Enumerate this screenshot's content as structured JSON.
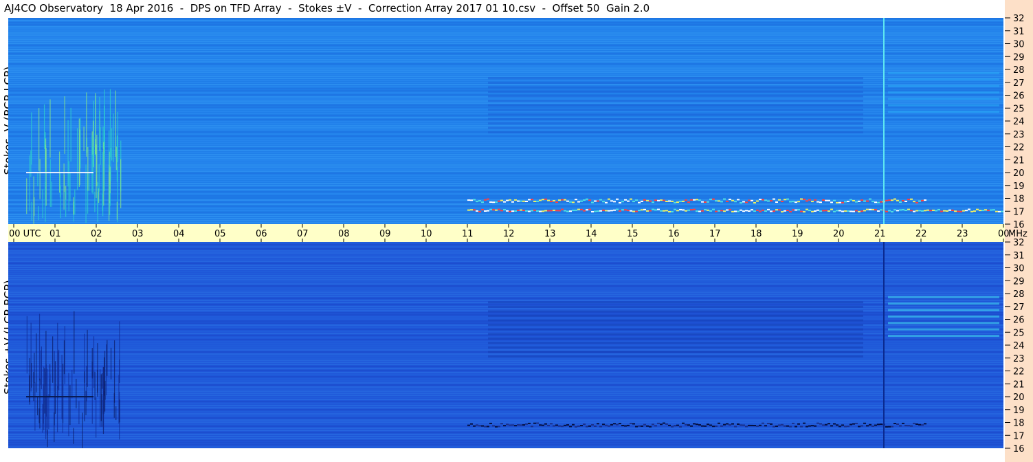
{
  "title": "AJ4CO Observatory  18 Apr 2016  -  DPS on TFD Array  -  Stokes ±V  -  Correction Array 2017 01 10.csv  -  Offset 50  Gain 2.0",
  "panels": {
    "top_ylabel": "Stokes -V (RCP-LCP)",
    "bottom_ylabel": "Stokes +V (LCP-RCP)"
  },
  "colors": {
    "time_axis_bg": "#ffffc8",
    "freq_axis_bg": "#fde0c8",
    "top_base": "#1f7ee8",
    "bottom_base": "#1f56d8"
  },
  "chart_data": [
    {
      "type": "heatmap",
      "name_label": "Stokes -V (RCP-LCP)",
      "x_ticks": [
        "00 UTC",
        "01",
        "02",
        "03",
        "04",
        "05",
        "06",
        "07",
        "08",
        "09",
        "10",
        "11",
        "12",
        "13",
        "14",
        "15",
        "16",
        "17",
        "18",
        "19",
        "20",
        "21",
        "22",
        "23",
        "00"
      ],
      "xlim": [
        0,
        24
      ],
      "y_unit": "MHz",
      "y_ticks": [
        16,
        17,
        18,
        19,
        20,
        21,
        22,
        23,
        24,
        25,
        26,
        27,
        28,
        29,
        30,
        31,
        32
      ],
      "ylim": [
        16,
        32
      ],
      "features": [
        {
          "kind": "burst",
          "t": [
            0.3,
            2.6
          ],
          "f": [
            16,
            22
          ]
        },
        {
          "kind": "band",
          "t": [
            11,
            22.1
          ],
          "f": [
            17.6,
            18.0
          ]
        },
        {
          "kind": "band",
          "t": [
            11,
            24
          ],
          "f": [
            16.9,
            17.2
          ]
        },
        {
          "kind": "line",
          "t": 21.1,
          "f": [
            16,
            32
          ]
        }
      ]
    },
    {
      "type": "heatmap",
      "name_label": "Stokes +V (LCP-RCP)",
      "x_ticks": [
        "00 UTC",
        "01",
        "02",
        "03",
        "04",
        "05",
        "06",
        "07",
        "08",
        "09",
        "10",
        "11",
        "12",
        "13",
        "14",
        "15",
        "16",
        "17",
        "18",
        "19",
        "20",
        "21",
        "22",
        "23",
        "00"
      ],
      "xlim": [
        0,
        24
      ],
      "y_unit": "MHz",
      "y_ticks": [
        16,
        17,
        18,
        19,
        20,
        21,
        22,
        23,
        24,
        25,
        26,
        27,
        28,
        29,
        30,
        31,
        32
      ],
      "ylim": [
        16,
        32
      ],
      "features": [
        {
          "kind": "burst",
          "t": [
            0.3,
            2.6
          ],
          "f": [
            16,
            22
          ]
        },
        {
          "kind": "band",
          "t": [
            11,
            22.1
          ],
          "f": [
            17.6,
            18.0
          ]
        },
        {
          "kind": "line",
          "t": 21.1,
          "f": [
            16,
            32
          ]
        }
      ]
    }
  ]
}
